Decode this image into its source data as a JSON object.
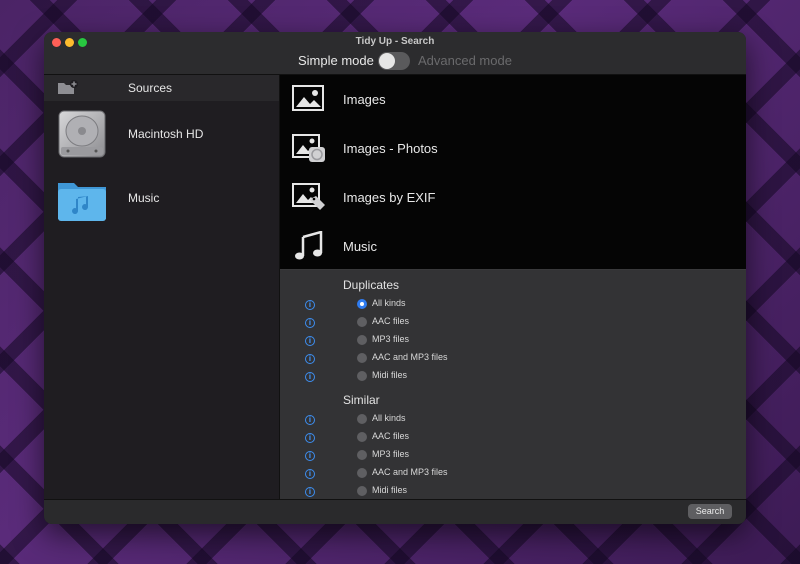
{
  "window": {
    "title": "Tidy Up - Search"
  },
  "mode": {
    "simple_label": "Simple mode",
    "advanced_label": "Advanced mode",
    "advanced_enabled": false
  },
  "sidebar": {
    "header_label": "Sources",
    "header_icon": "add-folder-icon",
    "sources": [
      {
        "label": "Macintosh HD",
        "icon": "hard-drive-icon"
      },
      {
        "label": "Music",
        "icon": "music-folder-icon"
      }
    ]
  },
  "presets": [
    {
      "label": "Images",
      "icon": "image-icon"
    },
    {
      "label": "Images - Photos",
      "icon": "photos-icon"
    },
    {
      "label": "Images by EXIF",
      "icon": "exif-tag-icon"
    },
    {
      "label": "Music",
      "icon": "music-note-icon"
    }
  ],
  "options": {
    "duplicates": {
      "title": "Duplicates",
      "items": [
        "All kinds",
        "AAC files",
        "MP3 files",
        "AAC and MP3 files",
        "Midi files"
      ],
      "selected_index": 0
    },
    "similar": {
      "title": "Similar",
      "items": [
        "All kinds",
        "AAC files",
        "MP3 files",
        "AAC and MP3 files",
        "Midi files"
      ],
      "selected_index": null
    },
    "info_icon": "info-icon",
    "accent_color": "#2f7cf0"
  },
  "footer": {
    "search_label": "Search"
  }
}
